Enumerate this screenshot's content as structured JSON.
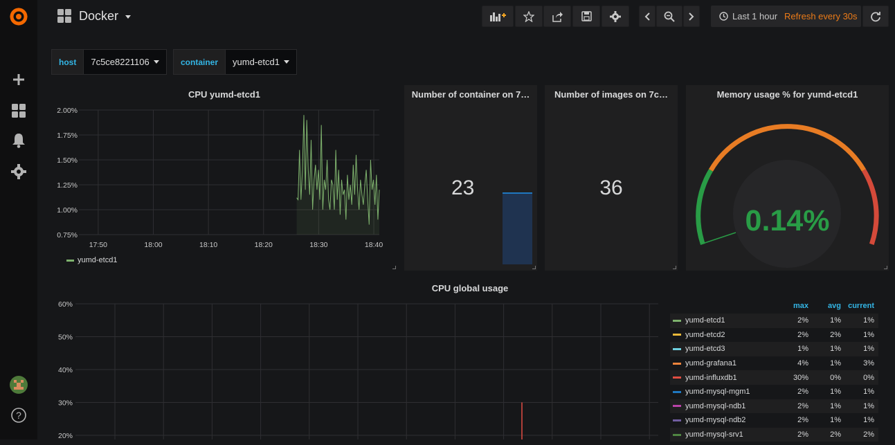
{
  "dashboard": {
    "title": "Docker"
  },
  "toolbar": {
    "time_range": "Last 1 hour",
    "refresh": "Refresh every 30s"
  },
  "variables": [
    {
      "label": "host",
      "value": "7c5ce8221106"
    },
    {
      "label": "container",
      "value": "yumd-etcd1"
    }
  ],
  "panels": {
    "cpu_container": {
      "title": "CPU yumd-etcd1",
      "legend": "yumd-etcd1"
    },
    "containers": {
      "title": "Number of container on 7…",
      "value": "23"
    },
    "images": {
      "title": "Number of images on 7c…",
      "value": "36"
    },
    "memory": {
      "title": "Memory usage % for yumd-etcd1",
      "value": "0.14%"
    },
    "cpu_global": {
      "title": "CPU global usage"
    }
  },
  "colors": {
    "accent": "#33b5e5",
    "refresh": "#eb7b18",
    "green": "#299c46",
    "orange": "#e87c24",
    "red": "#d44a3a",
    "series_green": "#7eb26d"
  },
  "chart_data": [
    {
      "type": "line",
      "title": "CPU yumd-etcd1",
      "x_ticks": [
        "17:50",
        "18:00",
        "18:10",
        "18:20",
        "18:30",
        "18:40"
      ],
      "y_ticks": [
        "2.00%",
        "1.75%",
        "1.50%",
        "1.25%",
        "1.00%",
        "0.75%"
      ],
      "ylim": [
        0.75,
        2.0
      ],
      "grid": true,
      "legend_position": "bottom",
      "series": [
        {
          "name": "yumd-etcd1",
          "color": "#7eb26d",
          "x_start": "18:26",
          "x_end": "18:41",
          "values": [
            1.12,
            1.1,
            1.6,
            1.1,
            1.4,
            1.95,
            1.2,
            1.9,
            1.4,
            1.15,
            1.7,
            1.0,
            1.3,
            1.45,
            1.2,
            1.4,
            1.1,
            1.85,
            1.0,
            1.3,
            1.2,
            1.5,
            1.1,
            1.0,
            1.3,
            1.25,
            1.0,
            1.6,
            1.1,
            1.4,
            0.95,
            1.3,
            1.15,
            1.2,
            0.9,
            1.35,
            1.1,
            1.25,
            1.05,
            1.45,
            1.15,
            1.55,
            1.2,
            1.0,
            1.3,
            1.15,
            1.05,
            1.25,
            1.4,
            1.1,
            0.85,
            1.5,
            1.2,
            1.3,
            1.05,
            1.35,
            0.9,
            1.2
          ]
        }
      ]
    },
    {
      "type": "line",
      "title": "CPU global usage",
      "y_ticks": [
        "60%",
        "50%",
        "40%",
        "30%",
        "20%"
      ],
      "ylim": [
        20,
        60
      ],
      "grid": true,
      "legend_position": "right",
      "legend_headers": [
        "max",
        "avg",
        "current"
      ],
      "series": [
        {
          "name": "yumd-etcd1",
          "color": "#7eb26d",
          "max": "2%",
          "avg": "1%",
          "current": "1%"
        },
        {
          "name": "yumd-etcd2",
          "color": "#eab839",
          "max": "2%",
          "avg": "2%",
          "current": "1%"
        },
        {
          "name": "yumd-etcd3",
          "color": "#6ed0e0",
          "max": "1%",
          "avg": "1%",
          "current": "1%"
        },
        {
          "name": "yumd-grafana1",
          "color": "#ef843c",
          "max": "4%",
          "avg": "1%",
          "current": "3%"
        },
        {
          "name": "yumd-influxdb1",
          "color": "#e24d42",
          "max": "30%",
          "avg": "0%",
          "current": "0%"
        },
        {
          "name": "yumd-mysql-mgm1",
          "color": "#1f78c1",
          "max": "2%",
          "avg": "1%",
          "current": "1%"
        },
        {
          "name": "yumd-mysql-ndb1",
          "color": "#ba43a9",
          "max": "2%",
          "avg": "1%",
          "current": "1%"
        },
        {
          "name": "yumd-mysql-ndb2",
          "color": "#705da0",
          "max": "2%",
          "avg": "1%",
          "current": "1%"
        },
        {
          "name": "yumd-mysql-srv1",
          "color": "#508642",
          "max": "2%",
          "avg": "2%",
          "current": "2%"
        }
      ],
      "spike": {
        "series": "yumd-influxdb1",
        "value": 30
      }
    }
  ]
}
